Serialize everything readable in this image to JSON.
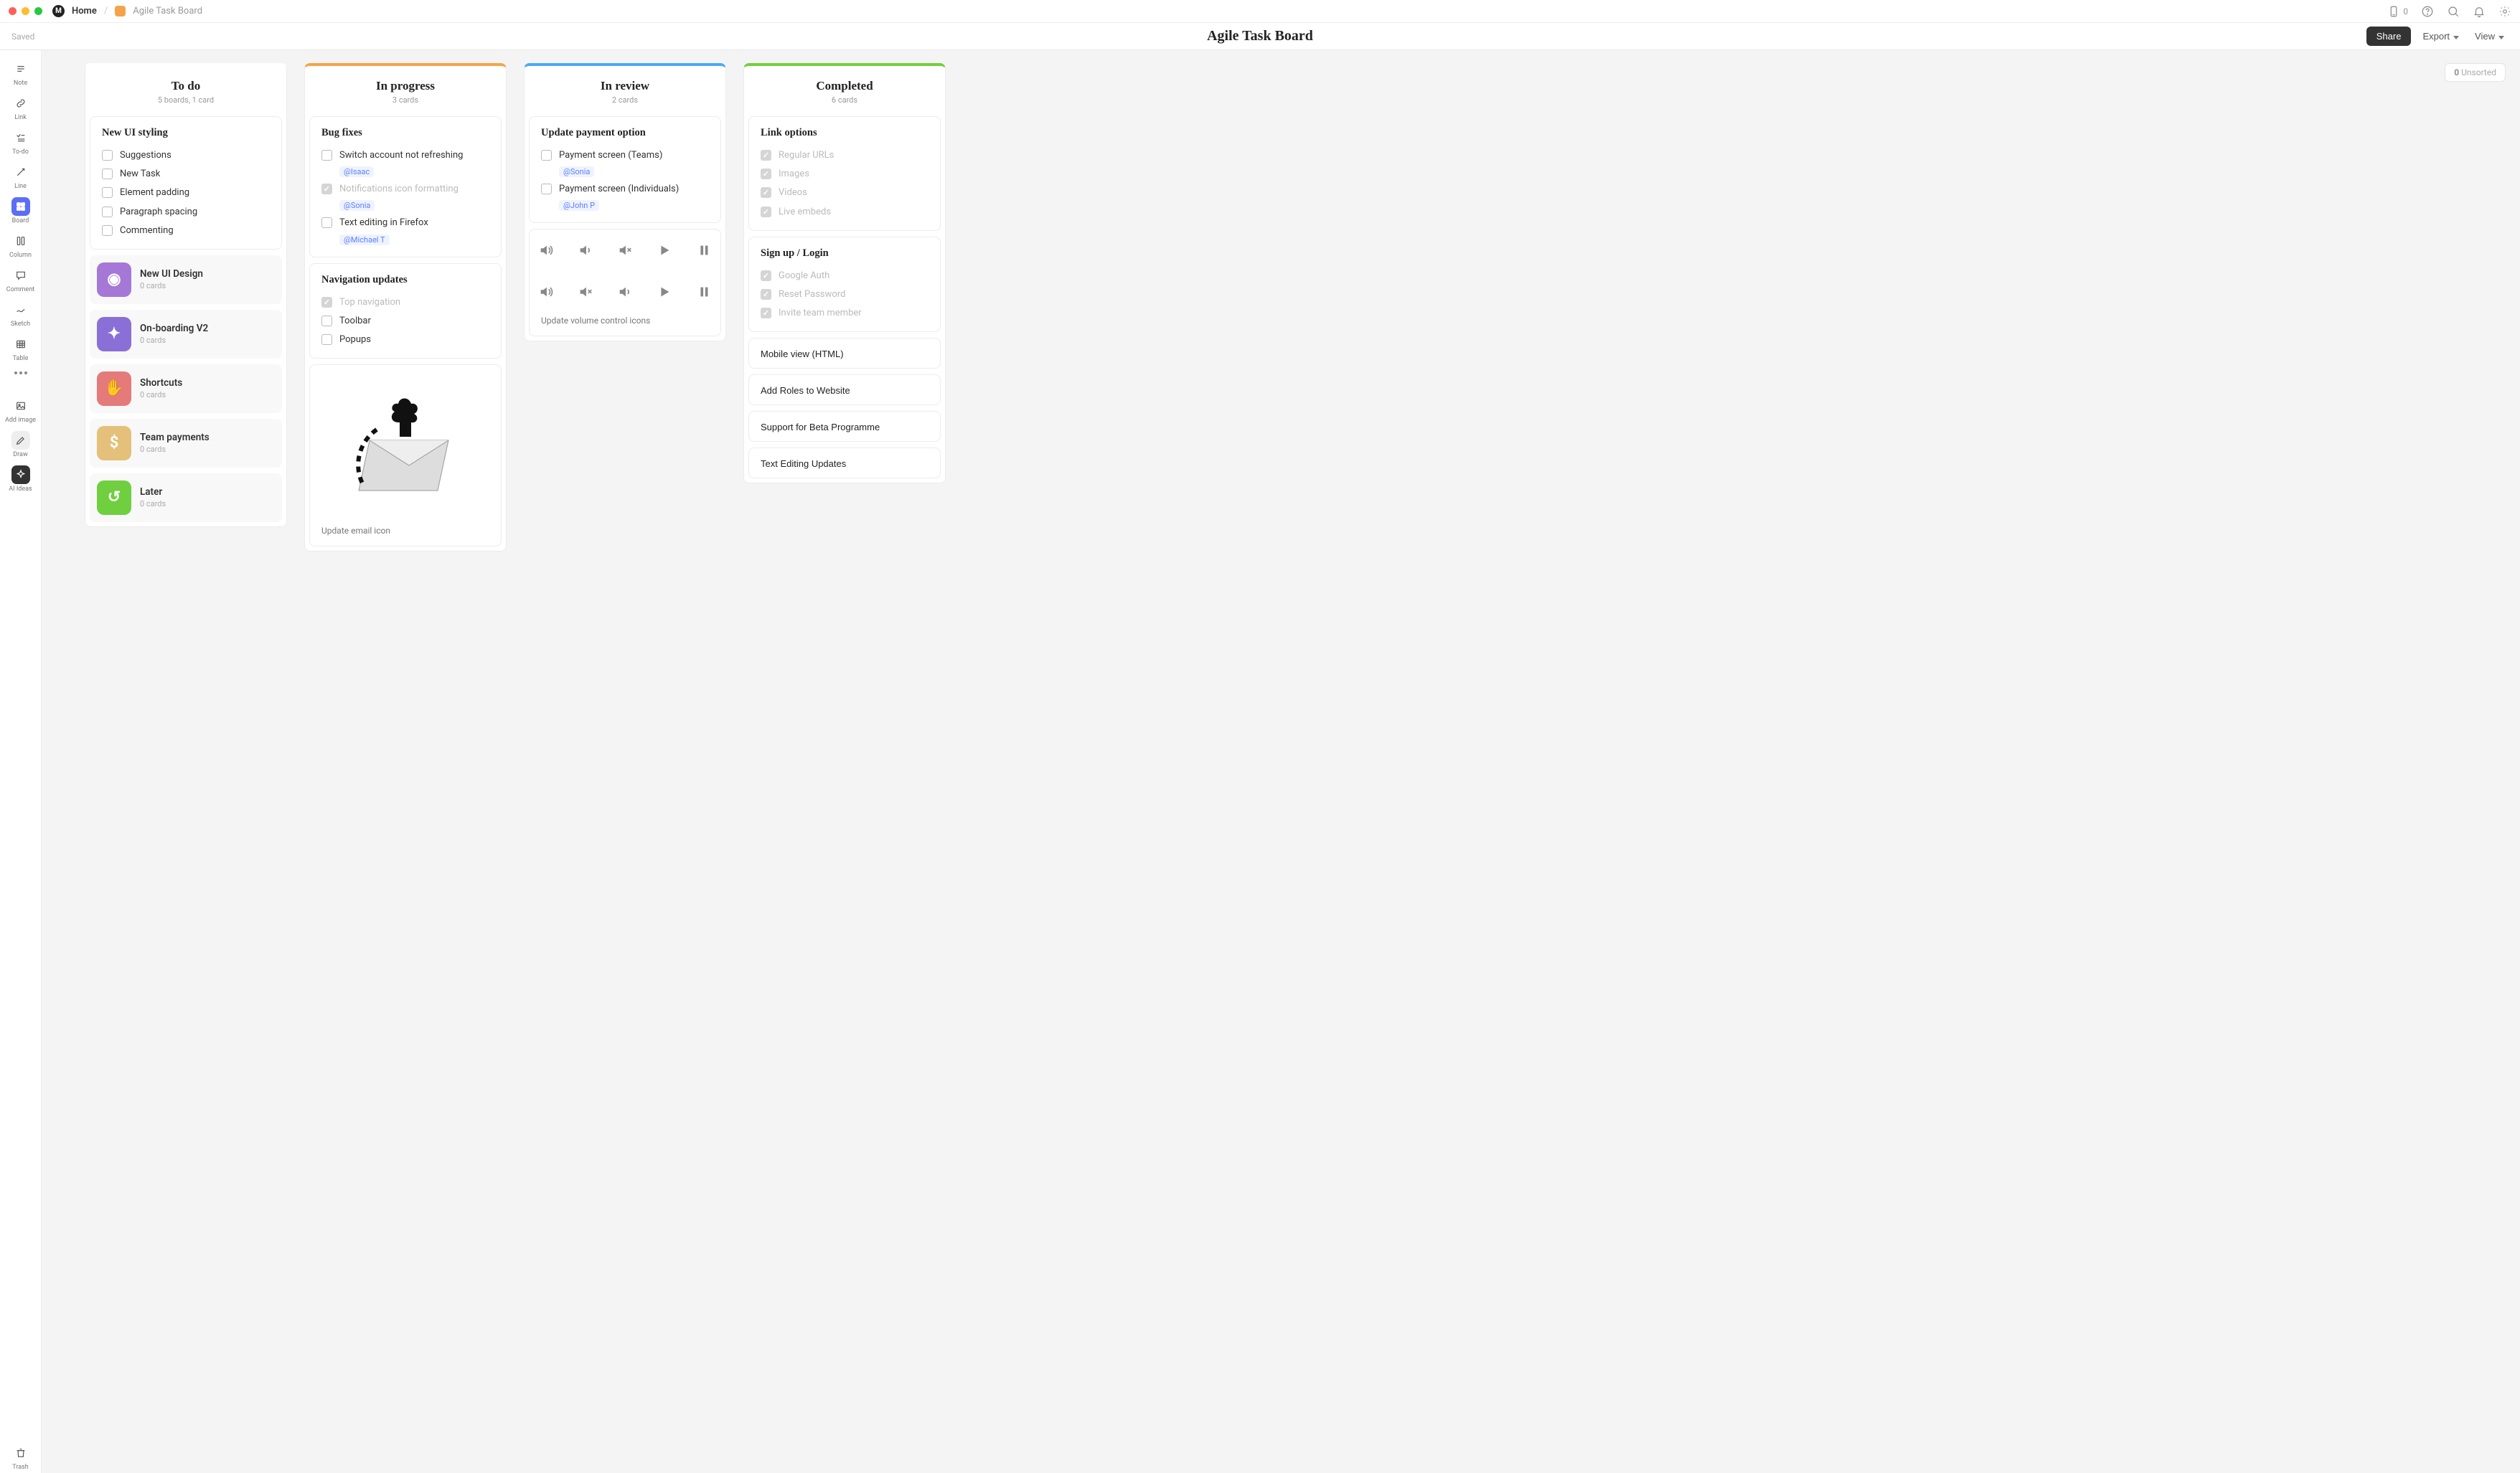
{
  "titlebar": {
    "home": "Home",
    "doc": "Agile Task Board",
    "mobile_count": "0"
  },
  "header": {
    "saved": "Saved",
    "title": "Agile Task Board",
    "share": "Share",
    "export": "Export",
    "view": "View"
  },
  "unsorted": {
    "count": "0",
    "label": "Unsorted"
  },
  "sidebar": {
    "items": [
      {
        "label": "Note"
      },
      {
        "label": "Link"
      },
      {
        "label": "To-do"
      },
      {
        "label": "Line"
      },
      {
        "label": "Board"
      },
      {
        "label": "Column"
      },
      {
        "label": "Comment"
      },
      {
        "label": "Sketch"
      },
      {
        "label": "Table"
      }
    ],
    "bottom": [
      {
        "label": "Add image"
      },
      {
        "label": "Draw"
      },
      {
        "label": "AI Ideas"
      }
    ],
    "trash": "Trash"
  },
  "columns": [
    {
      "title": "To do",
      "sub": "5 boards, 1 card",
      "accent": "none",
      "cards": [
        {
          "type": "checklist",
          "title": "New UI styling",
          "items": [
            {
              "text": "Suggestions",
              "done": false
            },
            {
              "text": "New Task",
              "done": false
            },
            {
              "text": "Element padding",
              "done": false
            },
            {
              "text": "Paragraph spacing",
              "done": false
            },
            {
              "text": "Commenting",
              "done": false
            }
          ]
        }
      ],
      "boards": [
        {
          "name": "New UI Design",
          "cnt": "0 cards",
          "color": "bi-purple"
        },
        {
          "name": "On-boarding V2",
          "cnt": "0 cards",
          "color": "bi-violet"
        },
        {
          "name": "Shortcuts",
          "cnt": "0 cards",
          "color": "bi-red"
        },
        {
          "name": "Team payments",
          "cnt": "0 cards",
          "color": "bi-tan"
        },
        {
          "name": "Later",
          "cnt": "0 cards",
          "color": "bi-green"
        }
      ]
    },
    {
      "title": "In progress",
      "sub": "3 cards",
      "accent": "orange",
      "cards": [
        {
          "type": "checklist",
          "title": "Bug fixes",
          "items": [
            {
              "text": "Switch account not refreshing",
              "done": false,
              "mention": "@Isaac"
            },
            {
              "text": "Notifications icon formatting",
              "done": true,
              "mention": "@Sonia"
            },
            {
              "text": "Text editing in Firefox",
              "done": false,
              "mention": "@Michael T"
            }
          ]
        },
        {
          "type": "checklist",
          "title": "Navigation updates",
          "items": [
            {
              "text": "Top navigation",
              "done": true
            },
            {
              "text": "Toolbar",
              "done": false
            },
            {
              "text": "Popups",
              "done": false
            }
          ]
        },
        {
          "type": "illus",
          "note": "Update email icon"
        }
      ]
    },
    {
      "title": "In review",
      "sub": "2 cards",
      "accent": "blue",
      "cards": [
        {
          "type": "checklist",
          "title": "Update payment option",
          "items": [
            {
              "text": "Payment screen (Teams)",
              "done": false,
              "mention": "@Sonia"
            },
            {
              "text": "Payment screen (Individuals)",
              "done": false,
              "mention": "@John P"
            }
          ]
        },
        {
          "type": "icons",
          "note": "Update volume control icons"
        }
      ]
    },
    {
      "title": "Completed",
      "sub": "6 cards",
      "accent": "green",
      "cards": [
        {
          "type": "checklist",
          "title": "Link options",
          "items": [
            {
              "text": "Regular URLs",
              "done": true
            },
            {
              "text": "Images",
              "done": true
            },
            {
              "text": "Videos",
              "done": true
            },
            {
              "text": "Live embeds",
              "done": true
            }
          ]
        },
        {
          "type": "checklist",
          "title": "Sign up / Login",
          "items": [
            {
              "text": "Google Auth",
              "done": true
            },
            {
              "text": "Reset Password",
              "done": true
            },
            {
              "text": "Invite team member",
              "done": true
            }
          ]
        },
        {
          "type": "simple",
          "title": "Mobile view (HTML)"
        },
        {
          "type": "simple",
          "title": "Add Roles to Website"
        },
        {
          "type": "simple",
          "title": "Support for Beta Programme"
        },
        {
          "type": "simple",
          "title": "Text Editing Updates"
        }
      ]
    }
  ]
}
